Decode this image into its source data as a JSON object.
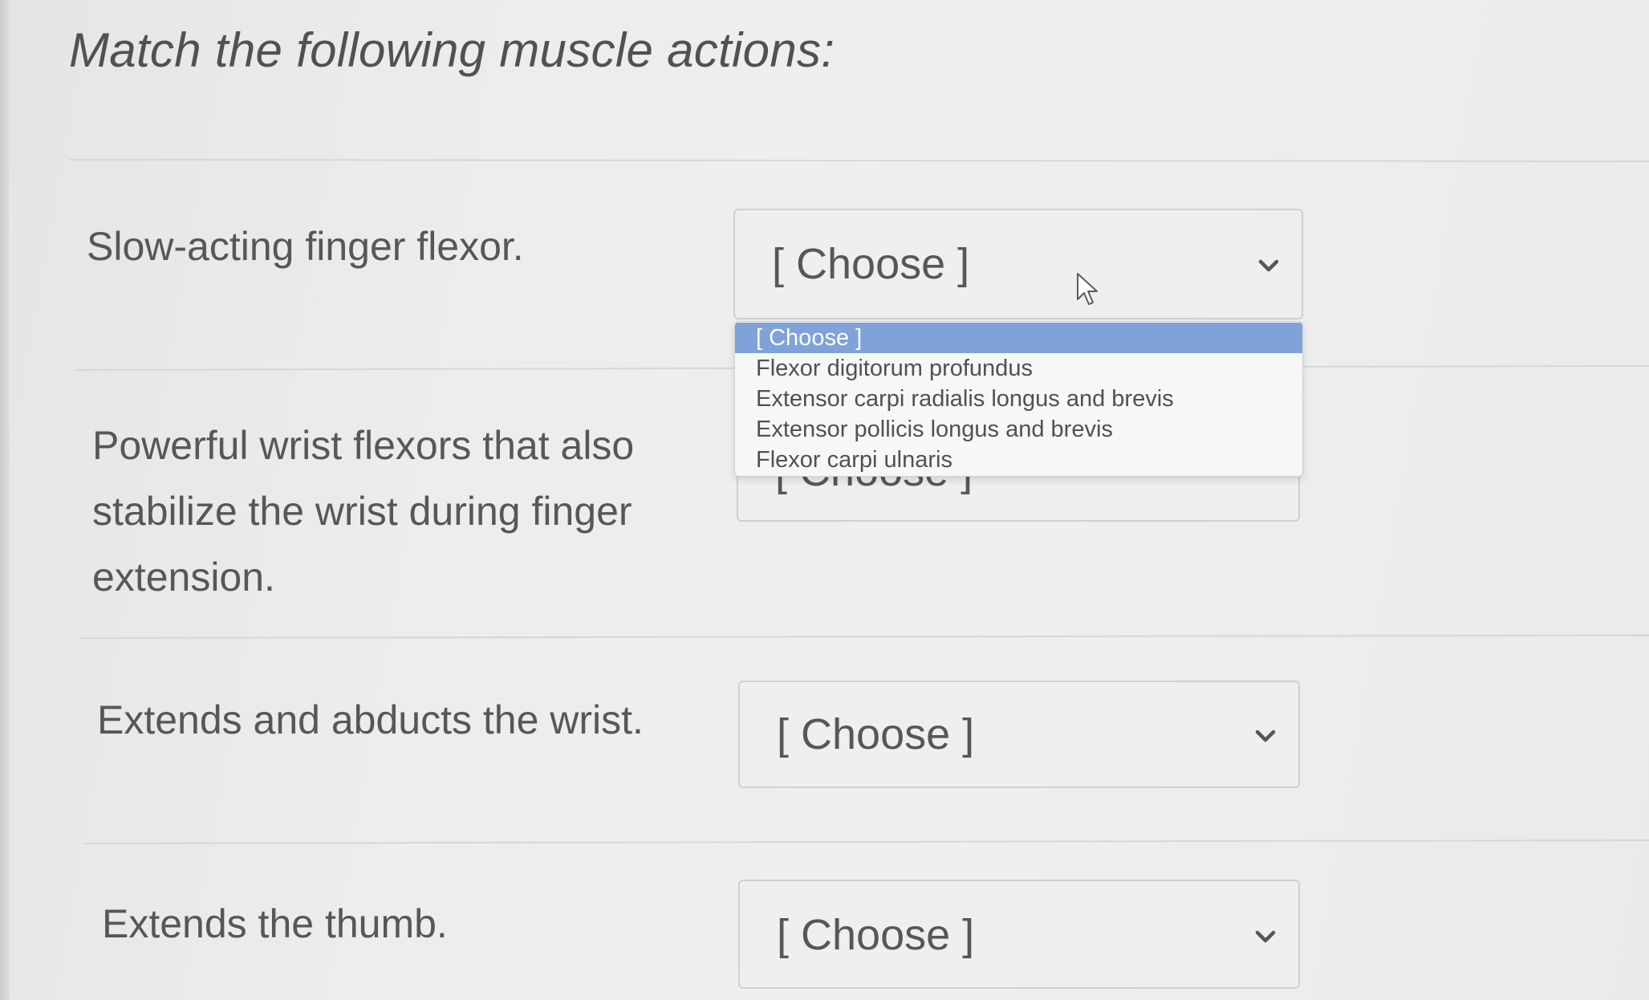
{
  "question": {
    "title": "Match the following muscle actions:"
  },
  "items": [
    {
      "prompt_lines": [
        "Slow-acting finger flexor."
      ],
      "select_value": "[ Choose ]"
    },
    {
      "prompt_lines": [
        "Powerful wrist flexors that also",
        "stabilize the wrist during finger",
        "extension."
      ],
      "select_value": "[ Choose ]"
    },
    {
      "prompt_lines": [
        "Extends and abducts the wrist."
      ],
      "select_value": "[ Choose ]"
    },
    {
      "prompt_lines": [
        "Extends the thumb."
      ],
      "select_value": "[ Choose ]"
    }
  ],
  "dropdown": {
    "selected_index": 0,
    "options": [
      "[ Choose ]",
      "Flexor digitorum profundus",
      "Extensor carpi radialis longus and brevis",
      "Extensor pollicis longus and brevis",
      "Flexor carpi ulnaris"
    ]
  },
  "icons": {
    "dropdown_arrow": "chevron-down-icon",
    "cursor": "mouse-pointer-icon"
  },
  "colors": {
    "highlight": "#7fa2d8",
    "text": "#55575a",
    "border": "#cfd1d0"
  }
}
